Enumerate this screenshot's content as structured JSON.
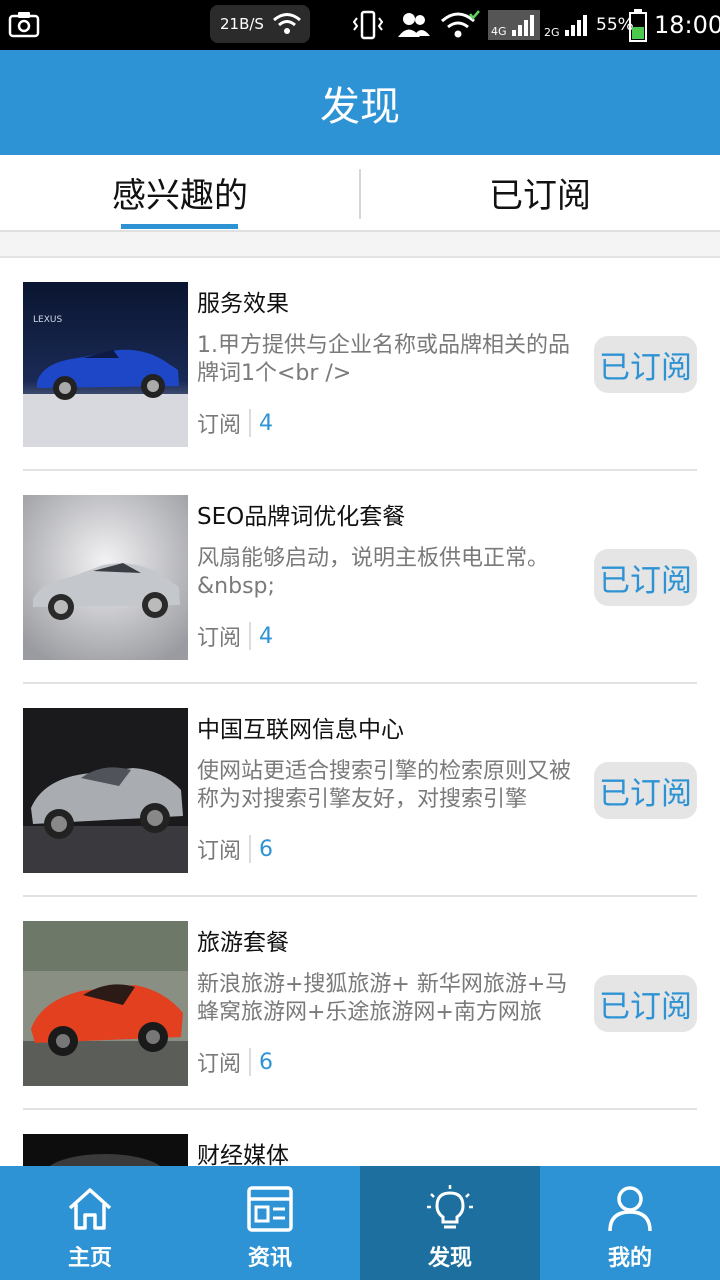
{
  "status_bar": {
    "net_speed": "21B/S",
    "battery_percent": "55%",
    "time": "18:00",
    "icons": [
      "screenshot-icon",
      "wifi-icon",
      "vibrate-icon",
      "contacts-icon",
      "wifi-icon",
      "4g-signal-icon",
      "2g-signal-icon",
      "battery-icon"
    ]
  },
  "header": {
    "title": "发现"
  },
  "tabs": [
    {
      "label": "感兴趣的",
      "active": true
    },
    {
      "label": "已订阅",
      "active": false
    }
  ],
  "items": [
    {
      "title": "服务效果",
      "desc": "1.甲方提供与企业名称或品牌相关的品牌词1个<br />",
      "meta_label": "订阅",
      "count": "4",
      "button": "已订阅",
      "thumb": "blue-convertible-car"
    },
    {
      "title": "SEO品牌词优化套餐",
      "desc": "风扇能够启动，说明主板供电正常。&nbsp;",
      "meta_label": "订阅",
      "count": "4",
      "button": "已订阅",
      "thumb": "silver-sports-car"
    },
    {
      "title": "中国互联网信息中心",
      "desc": "使网站更适合搜索引擎的检索原则又被称为对搜索引擎友好，对搜索引擎",
      "meta_label": "订阅",
      "count": "6",
      "button": "已订阅",
      "thumb": "silver-concept-roadster"
    },
    {
      "title": "旅游套餐",
      "desc": "新浪旅游+搜狐旅游+ 新华网旅游+马蜂窝旅游网+乐途旅游网+南方网旅",
      "meta_label": "订阅",
      "count": "6",
      "button": "已订阅",
      "thumb": "red-lamborghini"
    },
    {
      "title": "财经媒体",
      "desc": "",
      "meta_label": "",
      "count": "",
      "button": "",
      "thumb": "dark-car"
    }
  ],
  "bottom_nav": [
    {
      "label": "主页",
      "icon": "home-icon",
      "active": false
    },
    {
      "label": "资讯",
      "icon": "news-icon",
      "active": false
    },
    {
      "label": "发现",
      "icon": "lightbulb-icon",
      "active": true
    },
    {
      "label": "我的",
      "icon": "user-icon",
      "active": false
    }
  ],
  "colors": {
    "accent": "#2e93d4",
    "nav_active": "#1c6f9e",
    "button_bg": "#e5e5e5"
  }
}
